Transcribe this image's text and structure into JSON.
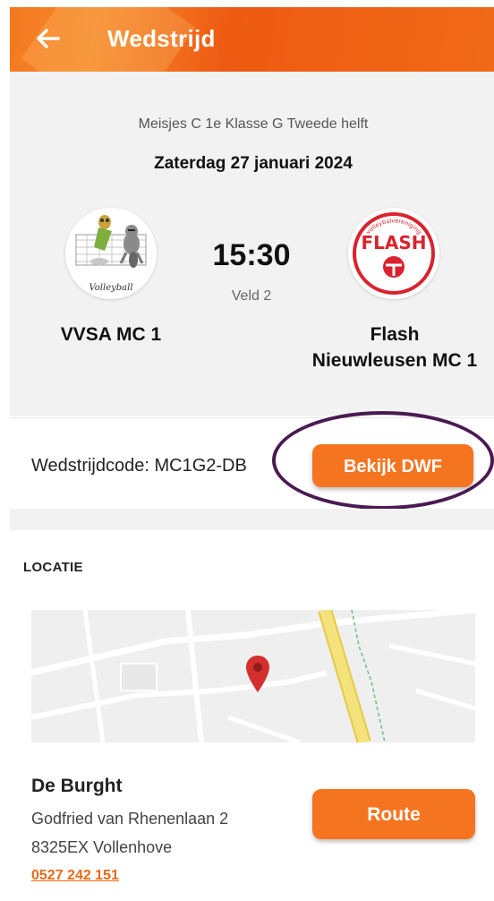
{
  "appbar": {
    "title": "Wedstrijd",
    "back_icon": "arrow-left-icon"
  },
  "match": {
    "competition": "Meisjes C 1e Klasse G Tweede helft",
    "date": "Zaterdag 27 januari 2024",
    "time": "15:30",
    "field": "Veld 2",
    "home": {
      "name": "VVSA MC 1",
      "logo_text": "Volleyball"
    },
    "away": {
      "name_line1": "Flash",
      "name_line2": "Nieuwleusen MC 1",
      "logo_text": "FLASH",
      "logo_arc_text": "volleybalvereniging"
    }
  },
  "code": {
    "text": "Wedstrijdcode: MC1G2-DB",
    "button": "Bekijk DWF"
  },
  "location": {
    "label": "LOCATIE",
    "venue": "De Burght",
    "address_line1": "Godfried van Rhenenlaan 2",
    "address_line2": "8325EX Vollenhove",
    "phone": "0527 242 151",
    "route_button": "Route"
  },
  "colors": {
    "accent": "#f57420",
    "highlight_ring": "#4a1a52",
    "pin": "#d32f2f"
  }
}
